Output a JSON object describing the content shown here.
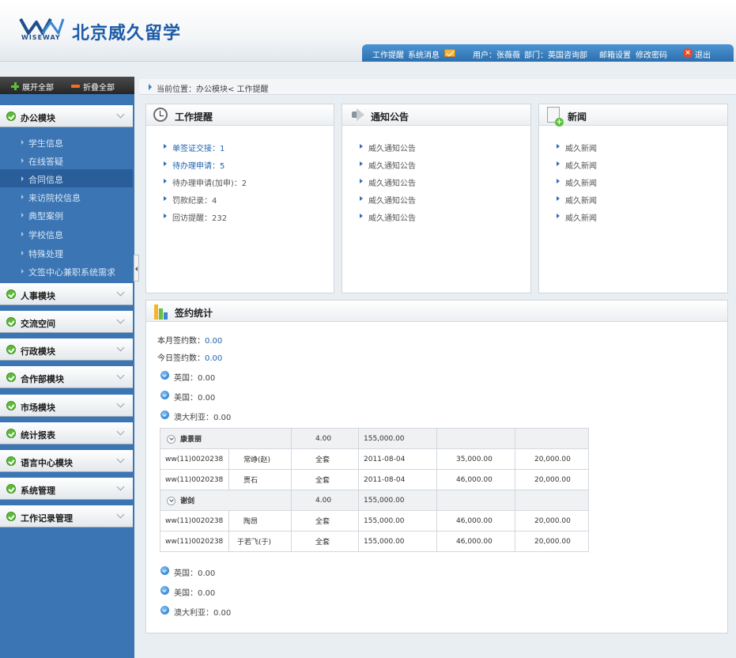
{
  "header": {
    "brand_en": "WISEWAY",
    "brand_cn": "北京威久留学",
    "topbar": {
      "reminder": "工作提醒",
      "messages": "系统消息",
      "user": "用户：张薇薇",
      "dept": "部门：英国咨询部",
      "mail_settings": "邮箱设置",
      "change_password": "修改密码",
      "logout": "退出"
    }
  },
  "sidebar": {
    "expand_all": "展开全部",
    "collapse_all": "折叠全部",
    "modules": [
      {
        "label": "办公模块"
      },
      {
        "label": "人事模块"
      },
      {
        "label": "交流空间"
      },
      {
        "label": "行政模块"
      },
      {
        "label": "合作部模块"
      },
      {
        "label": "市场模块"
      },
      {
        "label": "统计报表"
      },
      {
        "label": "语言中心模块"
      },
      {
        "label": "系统管理"
      },
      {
        "label": "工作记录管理"
      }
    ],
    "office_items": [
      {
        "label": "学生信息"
      },
      {
        "label": "在线答疑"
      },
      {
        "label": "合同信息"
      },
      {
        "label": "来访院校信息"
      },
      {
        "label": "典型案例"
      },
      {
        "label": "学校信息"
      },
      {
        "label": "特殊处理"
      },
      {
        "label": "文签中心兼职系统需求"
      }
    ]
  },
  "breadcrumb": "当前位置：办公模块< 工作提醒",
  "work_reminder": {
    "title": "工作提醒",
    "items": [
      {
        "label": "单签证交接：1"
      },
      {
        "label": "待办理申请：5"
      },
      {
        "label": "待办理申请(加申)：2"
      },
      {
        "label": "罚款纪录：4"
      },
      {
        "label": "回访提醒：232"
      }
    ]
  },
  "notices": {
    "title": "通知公告",
    "items": [
      {
        "label": "威久通知公告"
      },
      {
        "label": "威久通知公告"
      },
      {
        "label": "威久通知公告"
      },
      {
        "label": "威久通知公告"
      },
      {
        "label": "威久通知公告"
      }
    ]
  },
  "news": {
    "title": "新闻",
    "items": [
      {
        "label": "威久新闻"
      },
      {
        "label": "威久新闻"
      },
      {
        "label": "威久新闻"
      },
      {
        "label": "威久新闻"
      },
      {
        "label": "威久新闻"
      }
    ]
  },
  "sign_stats": {
    "title": "签约统计",
    "month_label": "本月签约数：",
    "month_value": "0.00",
    "today_label": "今日签约数：",
    "today_value": "0.00",
    "countries_top": [
      {
        "label": "英国：0.00"
      },
      {
        "label": "美国：0.00"
      },
      {
        "label": "澳大利亚：0.00"
      }
    ],
    "groups": [
      {
        "name": "康景丽",
        "count": "4.00",
        "total": "155,000.00",
        "rows": [
          {
            "code": "ww(11)0020238",
            "student": "常峥(赵)",
            "pkg": "全套",
            "col4": "2011-08-04",
            "col5": "35,000.00",
            "col6": "20,000.00"
          },
          {
            "code": "ww(11)0020238",
            "student": "贾石",
            "pkg": "全套",
            "col4": "2011-08-04",
            "col5": "46,000.00",
            "col6": "20,000.00"
          }
        ]
      },
      {
        "name": "谢剑",
        "count": "4.00",
        "total": "155,000.00",
        "rows": [
          {
            "code": "ww(11)0020238",
            "student": "陶昂",
            "pkg": "全套",
            "col4": "155,000.00",
            "col5": "46,000.00",
            "col6": "20,000.00"
          },
          {
            "code": "ww(11)0020238",
            "student": "于若飞(于)",
            "pkg": "全套",
            "col4": "155,000.00",
            "col5": "46,000.00",
            "col6": "20,000.00"
          }
        ]
      }
    ],
    "countries_bottom": [
      {
        "label": "英国：0.00"
      },
      {
        "label": "美国：0.00"
      },
      {
        "label": "澳大利亚：0.00"
      }
    ]
  }
}
